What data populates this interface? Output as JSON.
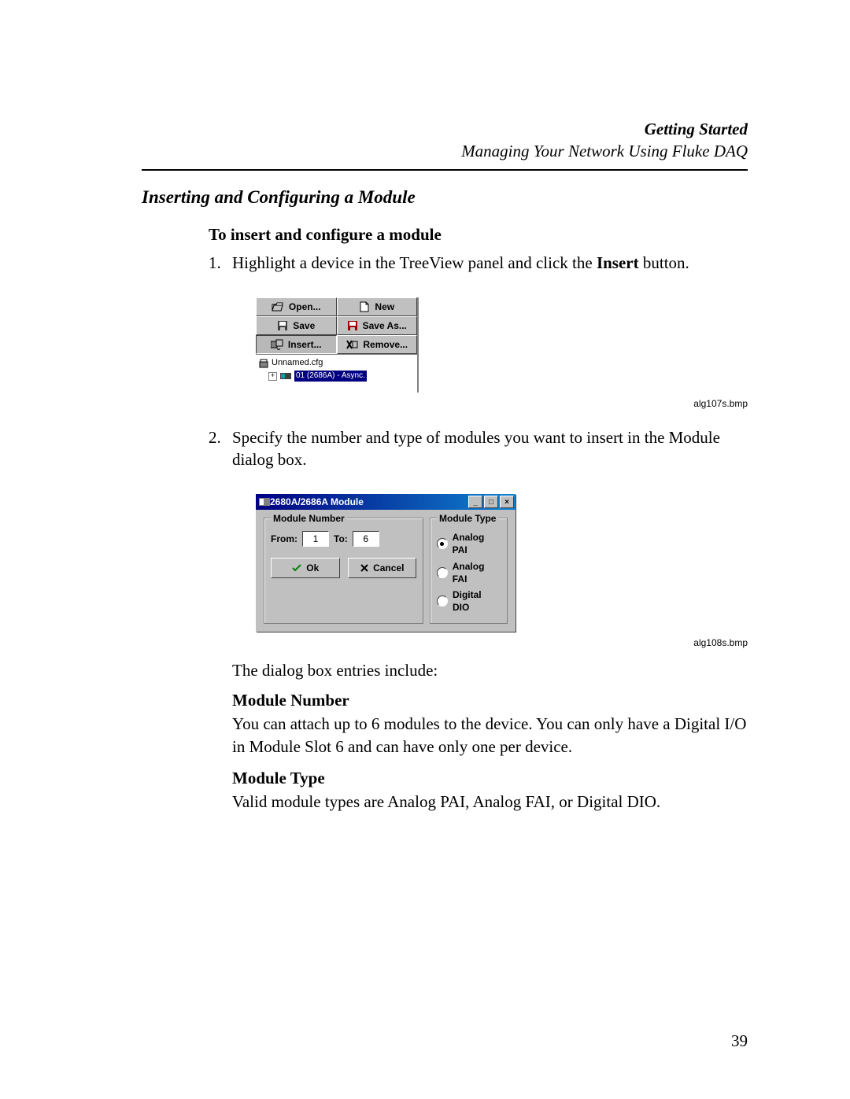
{
  "header": {
    "chapter": "Getting Started",
    "subtitle": "Managing Your Network Using Fluke DAQ"
  },
  "section_heading": "Inserting and Configuring a Module",
  "subheading": "To insert and configure a module",
  "steps": {
    "s1_pre": "Highlight a device in the TreeView panel and click the ",
    "s1_bold": "Insert",
    "s1_post": " button.",
    "s2": "Specify the number and type of modules you want to insert in the Module dialog box."
  },
  "captions": {
    "shot1": "alg107s.bmp",
    "shot2": "alg108s.bmp"
  },
  "paragraph_entries_intro": "The dialog box entries include:",
  "para_module_number_heading": "Module Number",
  "para_module_number_text": "You can attach up to 6 modules to the device. You can only have a Digital I/O in Module Slot 6 and can have only one per device.",
  "para_module_type_heading": "Module Type",
  "para_module_type_text": "Valid module types are Analog PAI, Analog FAI, or Digital DIO.",
  "page_number": "39",
  "shot1": {
    "buttons": {
      "open": "Open...",
      "new": "New",
      "save": "Save",
      "saveas": "Save As...",
      "insert": "Insert...",
      "remove": "Remove..."
    },
    "tree": {
      "root": "Unnamed.cfg",
      "child": "01 (2686A) - Async."
    }
  },
  "shot2": {
    "title": "2680A/2686A Module",
    "groups": {
      "module_number": "Module Number",
      "module_type": "Module Type"
    },
    "fields": {
      "from_label": "From:",
      "from_value": "1",
      "to_label": "To:",
      "to_value": "6"
    },
    "buttons": {
      "ok": "Ok",
      "cancel": "Cancel"
    },
    "radios": {
      "pai": "Analog PAI",
      "fai": "Analog FAI",
      "dio": "Digital DIO"
    }
  }
}
